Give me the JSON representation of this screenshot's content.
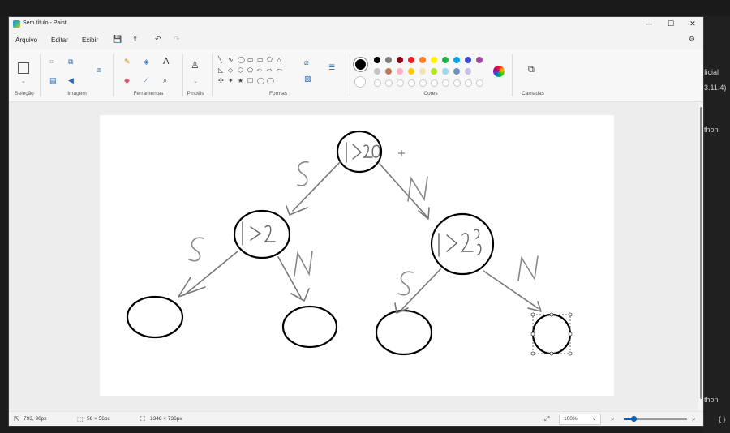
{
  "window": {
    "title": "Sem título - Paint"
  },
  "titlebar": {
    "minimize": "—",
    "maximize": "☐",
    "close": "✕"
  },
  "menu": {
    "items": [
      "Arquivo",
      "Editar",
      "Exibir"
    ]
  },
  "ribbon": {
    "groups": [
      "Seleção",
      "Imagem",
      "Ferramentas",
      "Pincéis",
      "Formas",
      "Cores",
      "Camadas"
    ],
    "text_tool": "A",
    "shapes": [
      "╲",
      "∿",
      "◯",
      "▭",
      "▭",
      "⬠",
      "△",
      "◺",
      "◇",
      "⬡",
      "⬠",
      "➪",
      "⇨",
      "⇦",
      "✣",
      "✦",
      "★",
      "☐",
      "◯",
      "◯"
    ],
    "colors": [
      "#000000",
      "#7f7f7f",
      "#880015",
      "#ed1c24",
      "#ff7f27",
      "#fff200",
      "#22b14c",
      "#00a2e8",
      "#3f48cc",
      "#a349a4"
    ],
    "colors_row2": [
      "#c3c3c3",
      "#b97a57",
      "#ffaec9",
      "#ffc90e",
      "#efe4b0",
      "#b5e61d",
      "#99d9ea",
      "#7092be",
      "#c8bfe7"
    ]
  },
  "drawing": {
    "root": "I>20",
    "left": "I>2",
    "right": "I>2",
    "labels": {
      "yes": "S",
      "no": "N"
    }
  },
  "status": {
    "cursor": "793, 90px",
    "selection": "56 × 56px",
    "canvas_size": "1348 × 736px",
    "zoom": "100%"
  },
  "background": {
    "right_texts": [
      "ficial",
      "3.11.4)",
      "thon",
      "thon",
      "{ }"
    ]
  }
}
